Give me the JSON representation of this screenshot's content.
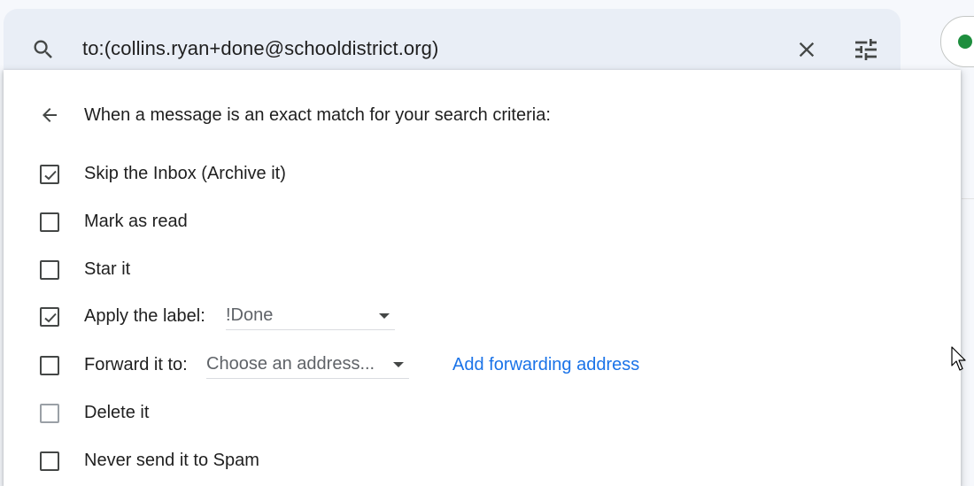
{
  "search": {
    "query": "to:(collins.ryan+done@schooldistrict.org)"
  },
  "filter_actions": {
    "heading": "When a message is an exact match for your search criteria:",
    "options": [
      {
        "label": "Skip the Inbox (Archive it)",
        "checked": true
      },
      {
        "label": "Mark as read",
        "checked": false
      },
      {
        "label": "Star it",
        "checked": false
      },
      {
        "label": "Apply the label:",
        "checked": true,
        "dropdown_value": "!Done"
      },
      {
        "label": "Forward it to:",
        "checked": false,
        "dropdown_value": "Choose an address...",
        "link": "Add forwarding address"
      },
      {
        "label": "Delete it",
        "checked": false,
        "disabled_look": true
      },
      {
        "label": "Never send it to Spam",
        "checked": false
      }
    ]
  },
  "colors": {
    "link": "#1a73e8",
    "status_dot": "#1e8e3e",
    "search_bg": "#e9eef6"
  }
}
